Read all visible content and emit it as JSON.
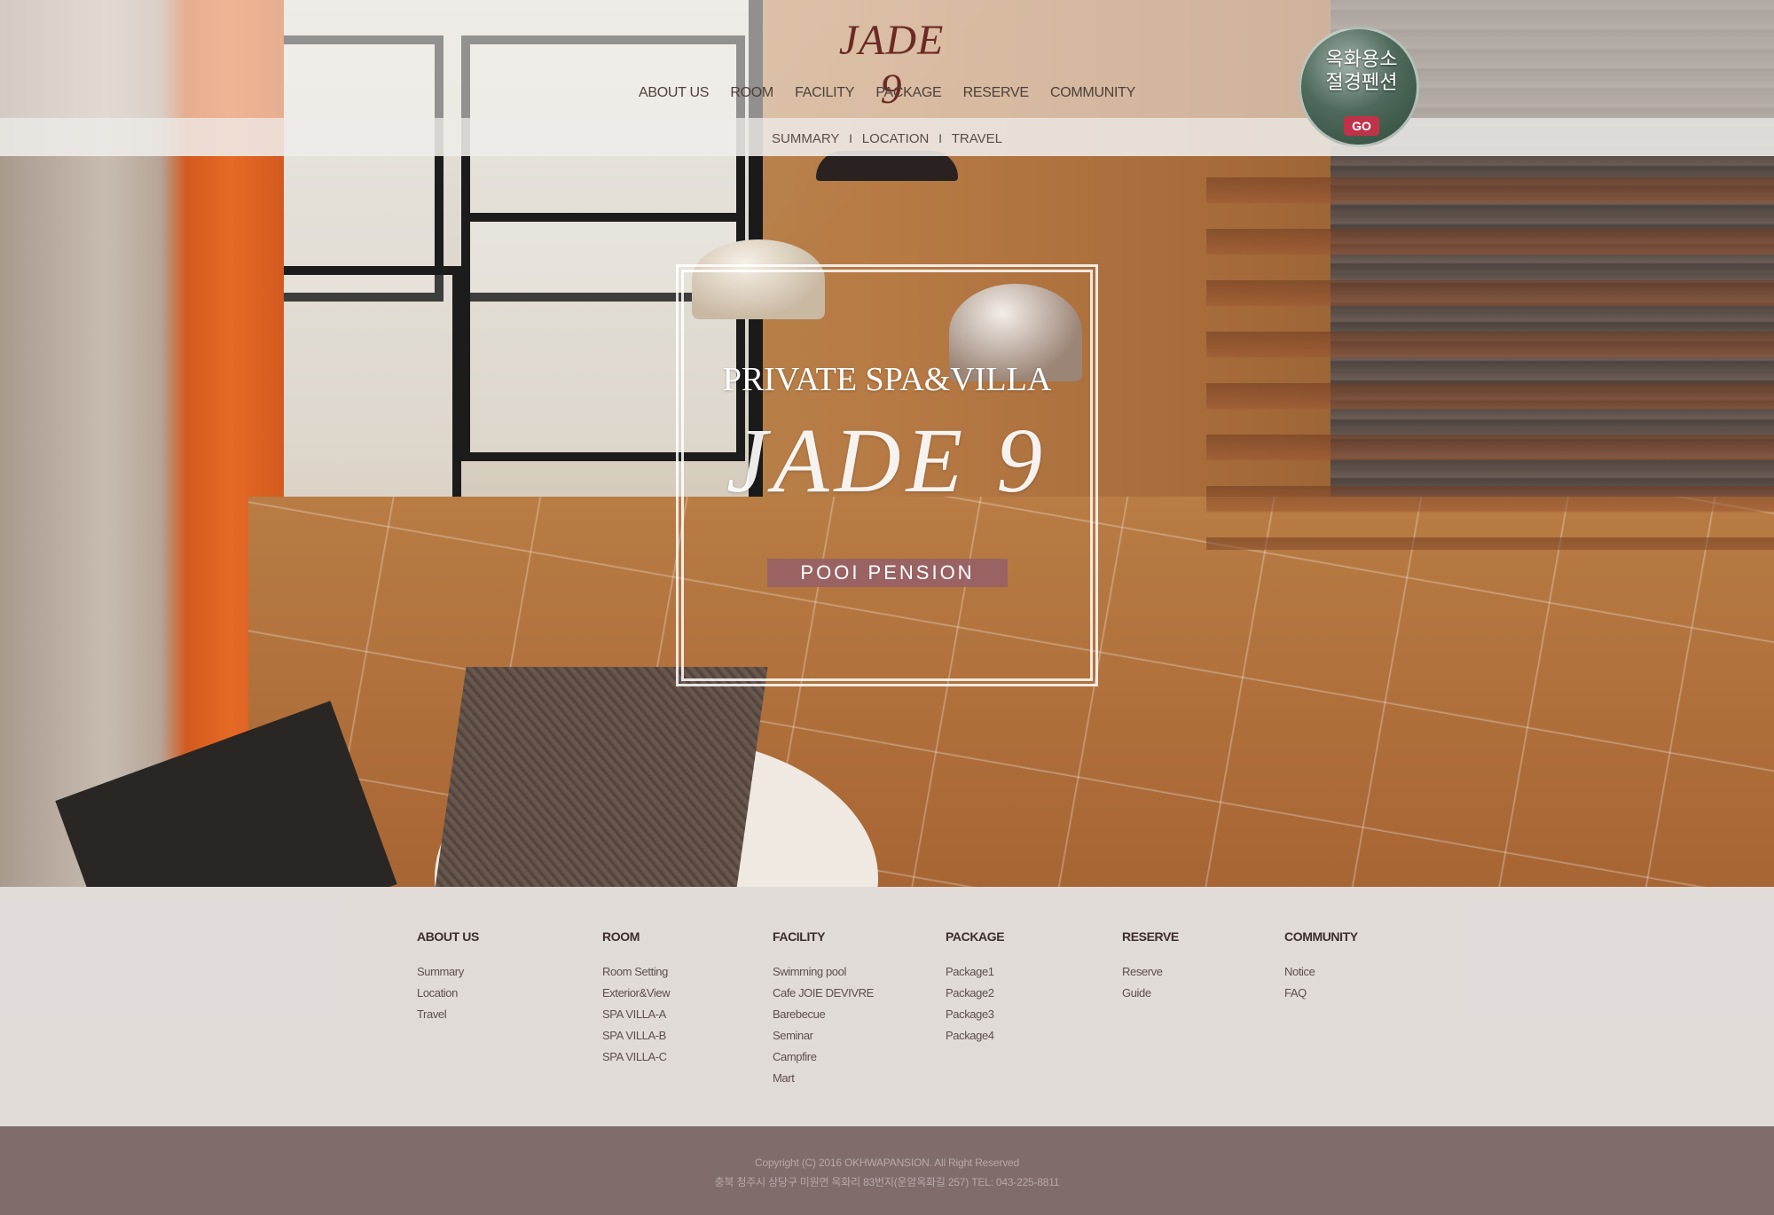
{
  "header": {
    "logo": "JADE 9",
    "nav": [
      "ABOUT US",
      "ROOM",
      "FACILITY",
      "PACKAGE",
      "RESERVE",
      "COMMUNITY"
    ],
    "subnav": [
      "SUMMARY",
      "LOCATION",
      "TRAVEL"
    ],
    "subnav_separator": "I"
  },
  "badge": {
    "line1": "옥화용소",
    "line2": "절경펜션",
    "go_label": "GO"
  },
  "hero": {
    "tagline": "PRIVATE SPA&VILLA",
    "logo": "JADE 9",
    "label": "POOI PENSION"
  },
  "sitemap": {
    "columns": [
      {
        "title": "ABOUT US",
        "items": [
          "Summary",
          "Location",
          "Travel"
        ]
      },
      {
        "title": "ROOM",
        "items": [
          "Room Setting",
          "Exterior&View",
          "SPA VILLA-A",
          "SPA VILLA-B",
          "SPA VILLA-C"
        ]
      },
      {
        "title": "FACILITY",
        "items": [
          "Swimming pool",
          "Cafe JOIE DEVIVRE",
          "Barebecue",
          "Seminar",
          "Campfire",
          "Mart"
        ]
      },
      {
        "title": "PACKAGE",
        "items": [
          "Package1",
          "Package2",
          "Package3",
          "Package4"
        ]
      },
      {
        "title": "RESERVE",
        "items": [
          "Reserve",
          "Guide"
        ]
      },
      {
        "title": "COMMUNITY",
        "items": [
          "Notice",
          "FAQ"
        ]
      }
    ]
  },
  "footer": {
    "copyright": "Copyright (C) 2016 OKHWAPANSION. All Right Reserved",
    "address": "충북 청주시 상당구 미원면 옥화리 83번지(운암옥화길 257) TEL: 043-225-8811"
  },
  "colors": {
    "logo": "#6b2a24",
    "label_bg": "#966068",
    "go_button": "#c0324a",
    "footer_bg": "#7f6c6b"
  }
}
